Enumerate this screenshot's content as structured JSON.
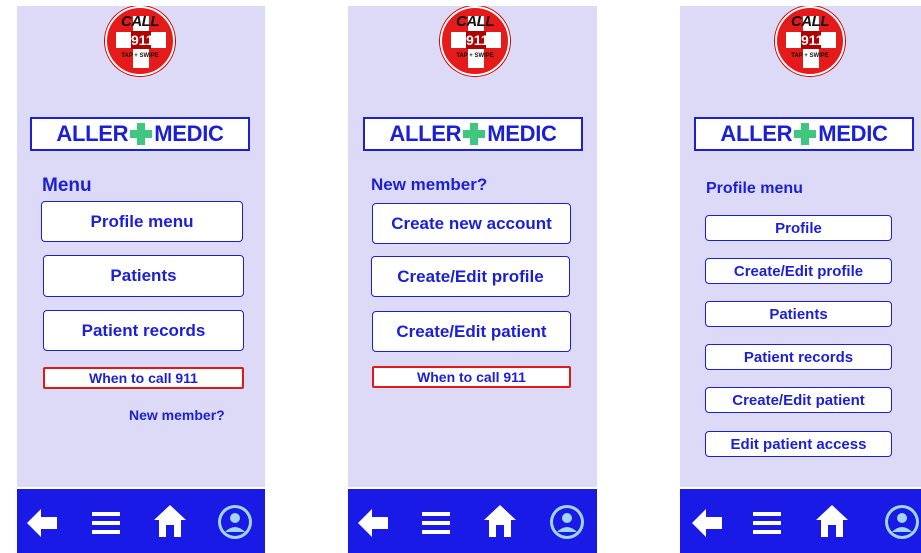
{
  "badge": {
    "call": "CALL",
    "number": "911",
    "tagline": "TAP + SWIPE"
  },
  "logo": {
    "left": "ALLER",
    "right": "MEDIC"
  },
  "screens": [
    {
      "heading": "Menu",
      "buttons": [
        "Profile menu",
        "Patients",
        "Patient records"
      ],
      "call_button": "When to call 911",
      "link": "New member?"
    },
    {
      "heading": "New member?",
      "buttons": [
        "Create new account",
        "Create/Edit profile",
        "Create/Edit patient"
      ],
      "call_button": "When to call 911"
    },
    {
      "heading": "Profile menu",
      "buttons": [
        "Profile",
        "Create/Edit profile",
        "Patients",
        "Patient records",
        "Create/Edit patient",
        "Edit patient access"
      ]
    }
  ],
  "colors": {
    "brand_blue": "#1b1fd6",
    "nav_blue": "#1a1ae6",
    "screen_bg": "#dcdaf7",
    "alert_red": "#e01818",
    "plus_green": "#3fc77f"
  },
  "nav_icons": [
    "back-arrow-icon",
    "menu-icon",
    "home-icon",
    "user-icon"
  ]
}
